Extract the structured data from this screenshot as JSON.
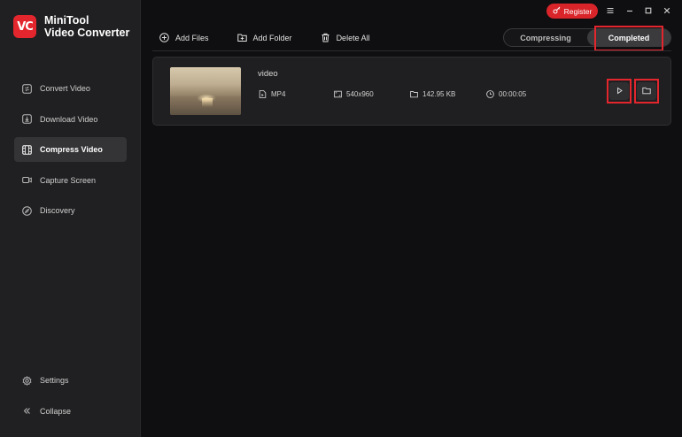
{
  "app": {
    "name_line1": "MiniTool",
    "name_line2": "Video Converter",
    "logo_text": "VC",
    "accent": "#e3262d"
  },
  "titlebar": {
    "register_label": "Register",
    "icons": [
      "menu-icon",
      "minimize-icon",
      "maximize-icon",
      "close-icon"
    ]
  },
  "sidebar": {
    "items": [
      {
        "label": "Convert Video",
        "icon": "convert-icon",
        "active": false
      },
      {
        "label": "Download Video",
        "icon": "download-icon",
        "active": false
      },
      {
        "label": "Compress Video",
        "icon": "compress-icon",
        "active": true
      },
      {
        "label": "Capture Screen",
        "icon": "camera-icon",
        "active": false
      },
      {
        "label": "Discovery",
        "icon": "compass-icon",
        "active": false
      }
    ],
    "bottom": [
      {
        "label": "Settings",
        "icon": "gear-icon"
      },
      {
        "label": "Collapse",
        "icon": "collapse-icon"
      }
    ]
  },
  "toolbar": {
    "add_files": "Add Files",
    "add_folder": "Add Folder",
    "delete_all": "Delete All"
  },
  "tabs": [
    {
      "label": "Compressing",
      "active": false
    },
    {
      "label": "Completed",
      "active": true
    }
  ],
  "file": {
    "name": "video",
    "format": "MP4",
    "resolution": "540x960",
    "size": "142.95 KB",
    "duration": "00:00:05"
  }
}
